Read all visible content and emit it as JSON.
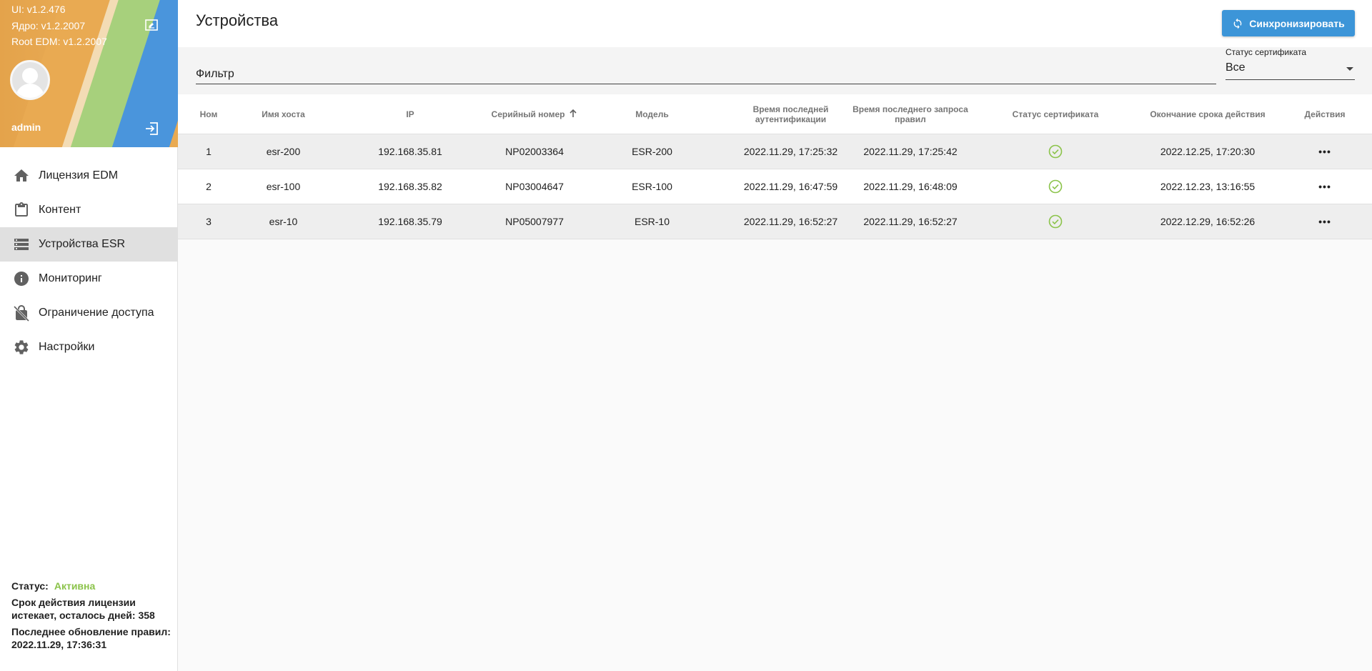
{
  "sidebar": {
    "versions": {
      "ui": "UI: v1.2.476",
      "core": "Ядро: v1.2.2007",
      "root": "Root EDM: v1.2.2007"
    },
    "user": "admin",
    "nav": [
      {
        "label": "Лицензия EDM",
        "icon": "home-icon"
      },
      {
        "label": "Контент",
        "icon": "clipboard-icon"
      },
      {
        "label": "Устройства ESR",
        "icon": "server-list-icon",
        "active": true
      },
      {
        "label": "Мониторинг",
        "icon": "info-icon"
      },
      {
        "label": "Ограничение доступа",
        "icon": "lock-off-icon"
      },
      {
        "label": "Настройки",
        "icon": "gear-icon"
      }
    ],
    "footer": {
      "status_label": "Статус:",
      "status_value": "Активна",
      "license_text": "Срок действия лицензии истекает, осталось дней: 358",
      "update_text": "Последнее обновление правил: 2022.11.29, 17:36:31"
    },
    "colors": {
      "status_active": "#8bc34a"
    }
  },
  "header": {
    "title": "Устройства",
    "sync_label": "Синхронизировать",
    "sync_color": "#3c95d8"
  },
  "filter": {
    "placeholder": "Фильтр",
    "cert_status_label": "Статус сертификата",
    "cert_status_value": "Все"
  },
  "table": {
    "columns": {
      "num": "Ном",
      "host": "Имя хоста",
      "ip": "IP",
      "serial": "Серийный номер",
      "model": "Модель",
      "last_auth": "Время последней аутентификации",
      "last_rules": "Время последнего запроса правил",
      "cert_status": "Статус сертификата",
      "expiry": "Окончание срока действия",
      "actions": "Действия"
    },
    "sort": {
      "column": "serial",
      "direction": "asc"
    },
    "rows": [
      {
        "num": "1",
        "host": "esr-200",
        "ip": "192.168.35.81",
        "serial": "NP02003364",
        "model": "ESR-200",
        "last_auth": "2022.11.29, 17:25:32",
        "last_rules": "2022.11.29, 17:25:42",
        "cert_ok": true,
        "expiry": "2022.12.25, 17:20:30",
        "actions": "•••"
      },
      {
        "num": "2",
        "host": "esr-100",
        "ip": "192.168.35.82",
        "serial": "NP03004647",
        "model": "ESR-100",
        "last_auth": "2022.11.29, 16:47:59",
        "last_rules": "2022.11.29, 16:48:09",
        "cert_ok": true,
        "expiry": "2022.12.23, 13:16:55",
        "actions": "•••"
      },
      {
        "num": "3",
        "host": "esr-10",
        "ip": "192.168.35.79",
        "serial": "NP05007977",
        "model": "ESR-10",
        "last_auth": "2022.11.29, 16:52:27",
        "last_rules": "2022.11.29, 16:52:27",
        "cert_ok": true,
        "expiry": "2022.12.29, 16:52:26",
        "actions": "•••"
      }
    ]
  }
}
